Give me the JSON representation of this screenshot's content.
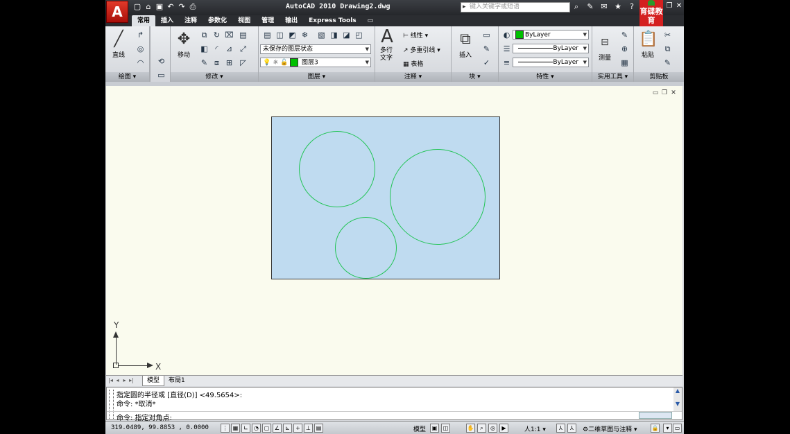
{
  "app": {
    "title": "AutoCAD 2010  Drawing2.dwg",
    "logo_letter": "A",
    "search_placeholder": "键入关键字或短语",
    "brand_logo": "育碟教育"
  },
  "tabs": [
    "常用",
    "插入",
    "注释",
    "参数化",
    "视图",
    "管理",
    "输出",
    "Express Tools"
  ],
  "ribbon": {
    "draw": {
      "title": "绘图",
      "line_label": "直线"
    },
    "modify": {
      "title": "修改",
      "move_label": "移动"
    },
    "layers": {
      "title": "图层",
      "layer_state": "未保存的图层状态",
      "current_layer": "图层3"
    },
    "annotation": {
      "title": "注释",
      "text_label": "多行文字",
      "linear_label": "线性",
      "mleader_label": "多重引线",
      "table_label": "表格"
    },
    "block": {
      "title": "块",
      "insert_label": "插入"
    },
    "properties": {
      "title": "特性",
      "color": "ByLayer",
      "linetype": "ByLayer",
      "lineweight": "ByLayer"
    },
    "utilities": {
      "title": "实用工具",
      "measure_label": "测量"
    },
    "clipboard": {
      "title": "剪贴板",
      "paste_label": "粘贴"
    }
  },
  "ucs": {
    "y_label": "Y",
    "x_label": "X"
  },
  "layout_tabs": [
    "模型",
    "布局1"
  ],
  "command": {
    "history": [
      "指定圆的半径或 [直径(D)] <49.5654>:",
      "命令: *取消*"
    ],
    "current": "命令: 指定对角点:"
  },
  "status": {
    "coordinates": "319.0489, 99.8853 , 0.0000",
    "model_label": "模型",
    "annotation_scale": "人1:1",
    "workspace": "二维草图与注释"
  },
  "colors": {
    "layer_color": "#00c000",
    "viewport_fill": "#bfdbf0",
    "circle_stroke": "#22c455",
    "canvas_bg": "#fafbee"
  }
}
